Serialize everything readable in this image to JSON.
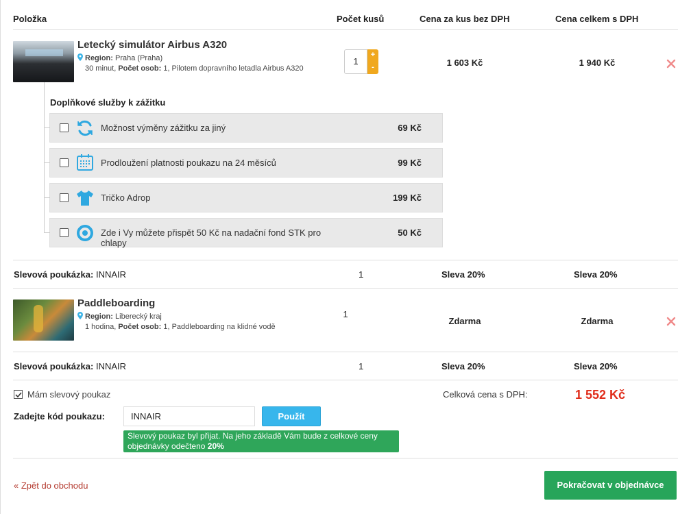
{
  "header": {
    "item": "Položka",
    "qty": "Počet kusů",
    "unit_price": "Cena za kus bez DPH",
    "total_price": "Cena celkem s DPH"
  },
  "products": [
    {
      "name": "Letecký simulátor Airbus A320",
      "region_label": "Region:",
      "region_value": "Praha (Praha)",
      "desc_duration": "30 minut,",
      "desc_persons_label": "Počet osob:",
      "desc_persons_value": "1, Pilotem dopravního letadla Airbus A320",
      "qty": "1",
      "unit_price": "1 603 Kč",
      "total_price": "1 940 Kč"
    },
    {
      "name": "Paddleboarding",
      "region_label": "Region:",
      "region_value": "Liberecký kraj",
      "desc_duration": "1 hodina,",
      "desc_persons_label": "Počet osob:",
      "desc_persons_value": "1, Paddleboarding na klidné vodě",
      "qty": "1",
      "unit_price": "Zdarma",
      "total_price": "Zdarma"
    }
  ],
  "addons": {
    "title": "Doplňkové služby k zážitku",
    "items": [
      {
        "icon": "exchange-icon",
        "label": "Možnost výměny zážitku za jiný",
        "price": "69 Kč"
      },
      {
        "icon": "calendar-icon",
        "label": "Prodloužení platnosti poukazu na 24 měsíců",
        "price": "99 Kč"
      },
      {
        "icon": "tshirt-icon",
        "label": "Tričko Adrop",
        "price": "199 Kč"
      },
      {
        "icon": "ribbon-icon",
        "label": "Zde i Vy můžete přispět 50 Kč na nadační fond STK pro chlapy",
        "price": "50 Kč"
      }
    ]
  },
  "discounts": [
    {
      "label": "Slevová poukázka:",
      "code": "INNAIR",
      "qty": "1",
      "unit": "Sleva 20%",
      "total": "Sleva 20%"
    },
    {
      "label": "Slevová poukázka:",
      "code": "INNAIR",
      "qty": "1",
      "unit": "Sleva 20%",
      "total": "Sleva 20%"
    }
  ],
  "voucher": {
    "checkbox_label": "Mám slevový poukaz",
    "code_label": "Zadejte kód poukazu:",
    "code_value": "INNAIR",
    "apply_label": "Použít",
    "success_text": "Slevový poukaz byl přijat. Na jeho základě Vám bude z celkové ceny objednávky odečteno",
    "success_amount": "20%"
  },
  "summary": {
    "total_label": "Celková cena s DPH:",
    "total_value": "1 552 Kč"
  },
  "nav": {
    "back_label": "« Zpět do obchodu",
    "continue_label": "Pokračovat v objednávce"
  },
  "colors": {
    "accent_blue": "#37b6ec",
    "accent_green": "#27a55a",
    "total_red": "#e02d1b",
    "qty_orange": "#f0a81e",
    "remove_red": "#f08a8a"
  }
}
